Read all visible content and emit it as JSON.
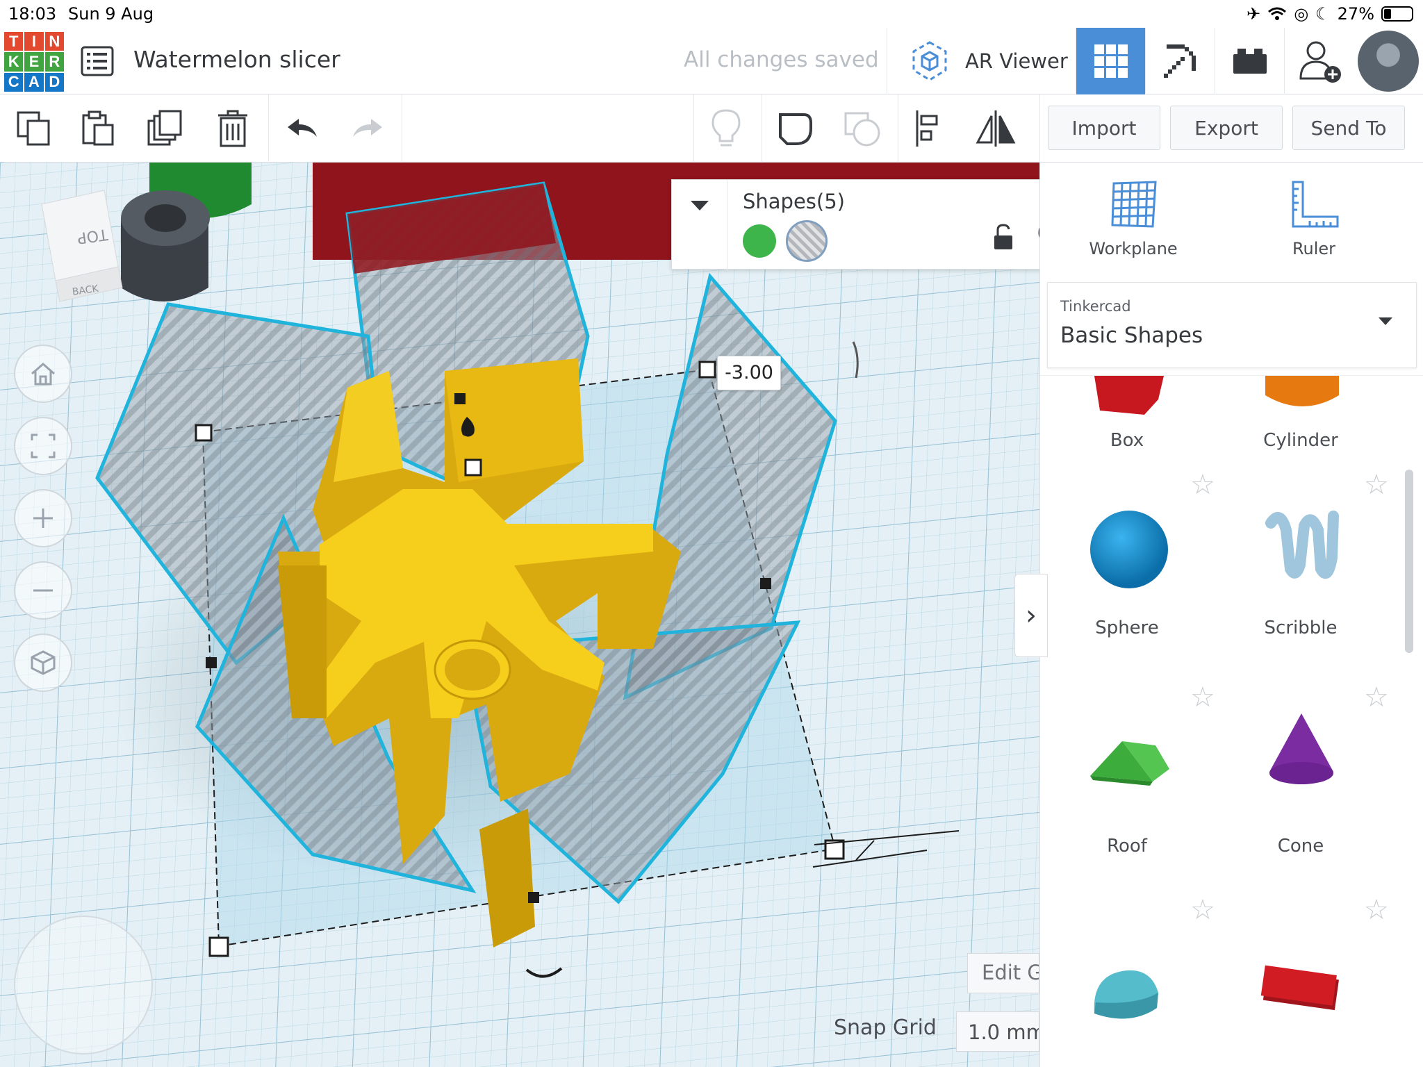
{
  "status": {
    "time": "18:03",
    "date": "Sun 9 Aug",
    "battery": "27%",
    "battery_level": 0.27
  },
  "header": {
    "logo_letters": [
      "T",
      "I",
      "N",
      "K",
      "E",
      "R",
      "C",
      "A",
      "D"
    ],
    "logo_colors": [
      "#e2492f",
      "#e2492f",
      "#e2492f",
      "#40a441",
      "#40a441",
      "#40a441",
      "#1476c6",
      "#1476c6",
      "#1476c6"
    ],
    "title": "Watermelon slicer",
    "save_status": "All changes saved",
    "ar_label": "AR Viewer"
  },
  "toolbar": {
    "import": "Import",
    "export": "Export",
    "send_to": "Send To"
  },
  "inspector": {
    "title": "Shapes(5)"
  },
  "viewport": {
    "dimension_value": "-3.00",
    "viewcube_top": "TOP",
    "viewcube_back": "BACK",
    "edit_grid": "Edit Grid",
    "snap_grid_label": "Snap Grid",
    "snap_grid_value": "1.0 mm"
  },
  "panel": {
    "workplane": "Workplane",
    "ruler": "Ruler",
    "library_provider": "Tinkercad",
    "library_name": "Basic Shapes",
    "shapes": [
      "Box",
      "Cylinder",
      "Sphere",
      "Scribble",
      "Roof",
      "Cone"
    ]
  },
  "colors": {
    "accent": "#4b8ed8",
    "hole": "#3db54a",
    "shape_yellow": "#f2c51a",
    "selection": "#20b4dc"
  }
}
